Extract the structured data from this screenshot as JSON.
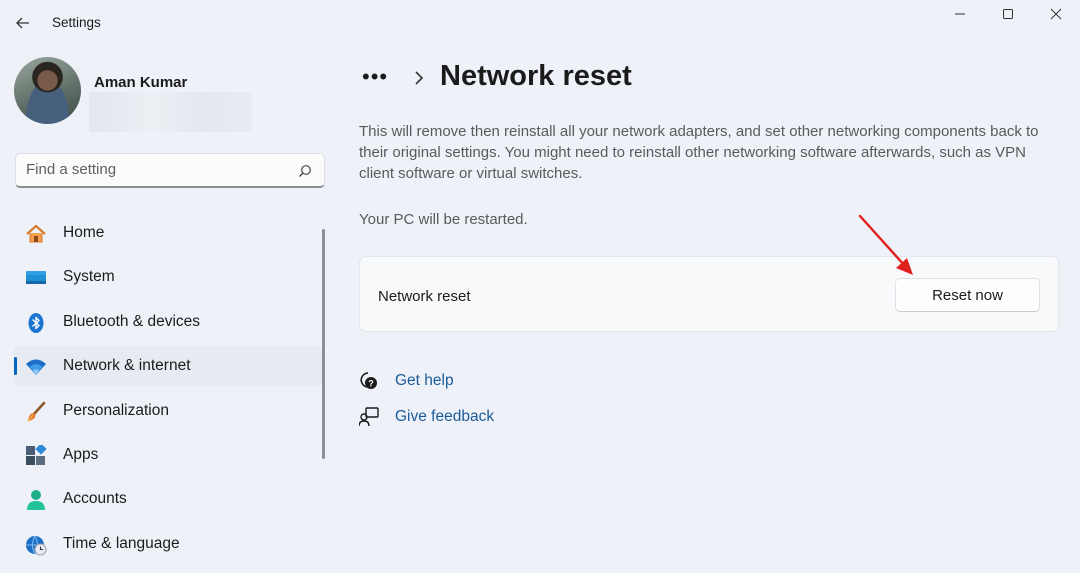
{
  "window": {
    "title": "Settings"
  },
  "profile": {
    "name": "Aman Kumar"
  },
  "search": {
    "placeholder": "Find a setting"
  },
  "sidebar": {
    "items": [
      {
        "label": "Home",
        "icon": "home-icon",
        "active": false
      },
      {
        "label": "System",
        "icon": "system-icon",
        "active": false
      },
      {
        "label": "Bluetooth & devices",
        "icon": "bluetooth-icon",
        "active": false
      },
      {
        "label": "Network & internet",
        "icon": "wifi-icon",
        "active": true
      },
      {
        "label": "Personalization",
        "icon": "brush-icon",
        "active": false
      },
      {
        "label": "Apps",
        "icon": "apps-icon",
        "active": false
      },
      {
        "label": "Accounts",
        "icon": "accounts-icon",
        "active": false
      },
      {
        "label": "Time & language",
        "icon": "globe-clock-icon",
        "active": false
      }
    ]
  },
  "main": {
    "breadcrumb_more": "•••",
    "title": "Network reset",
    "description": "This will remove then reinstall all your network adapters, and set other networking components back to their original settings. You might need to reinstall other networking software afterwards, such as VPN client software or virtual switches.",
    "restart_note": "Your PC will be restarted.",
    "card": {
      "label": "Network reset",
      "button_label": "Reset now"
    },
    "links": {
      "get_help": "Get help",
      "give_feedback": "Give feedback"
    }
  },
  "colors": {
    "accent": "#0067c0",
    "link": "#1a5a9a",
    "annotation_arrow": "#e0201e"
  }
}
